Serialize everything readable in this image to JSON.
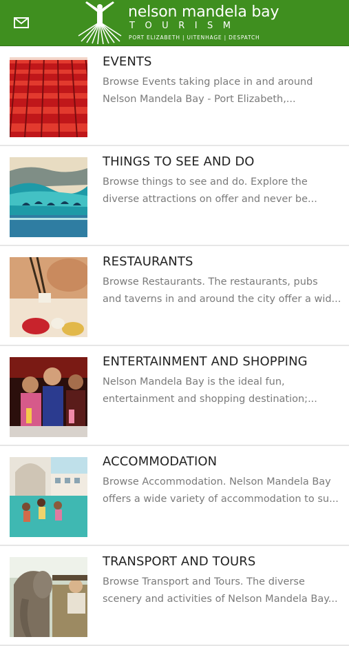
{
  "header": {
    "mail_icon": "envelope-icon",
    "logo_name": "nelson mandela bay",
    "logo_sub": "TOURISM",
    "logo_tag": "PORT ELIZABETH | UITENHAGE | DESPATCH",
    "brand_color": "#3f8f1f"
  },
  "categories": [
    {
      "title": "EVENTS",
      "line1": "Browse Events taking place in and around",
      "line2": "Nelson Mandela Bay - Port Elizabeth,...",
      "image": "stadium-seats-photo"
    },
    {
      "title": "THINGS TO SEE AND DO",
      "line1": "Browse things to see and do. Explore the",
      "line2": "diverse attractions on offer and never be...",
      "image": "dolphins-wave-photo"
    },
    {
      "title": "RESTAURANTS",
      "line1": "Browse Restaurants. The restaurants, pubs",
      "line2": "and taverns in and around the city offer a wid...",
      "image": "sushi-chopsticks-photo"
    },
    {
      "title": "ENTERTAINMENT AND SHOPPING",
      "line1": "Nelson Mandela Bay is the ideal fun,",
      "line2": "entertainment and shopping destination;...",
      "image": "nightlife-people-photo"
    },
    {
      "title": "ACCOMMODATION",
      "line1": "Browse Accommodation. Nelson Mandela Bay",
      "line2": "offers a wide variety of accommodation to su...",
      "image": "hotel-pool-photo"
    },
    {
      "title": "TRANSPORT AND TOURS",
      "line1": "Browse Transport and Tours. The diverse",
      "line2": "scenery and activities of Nelson Mandela Bay...",
      "image": "elephant-safari-photo"
    }
  ]
}
